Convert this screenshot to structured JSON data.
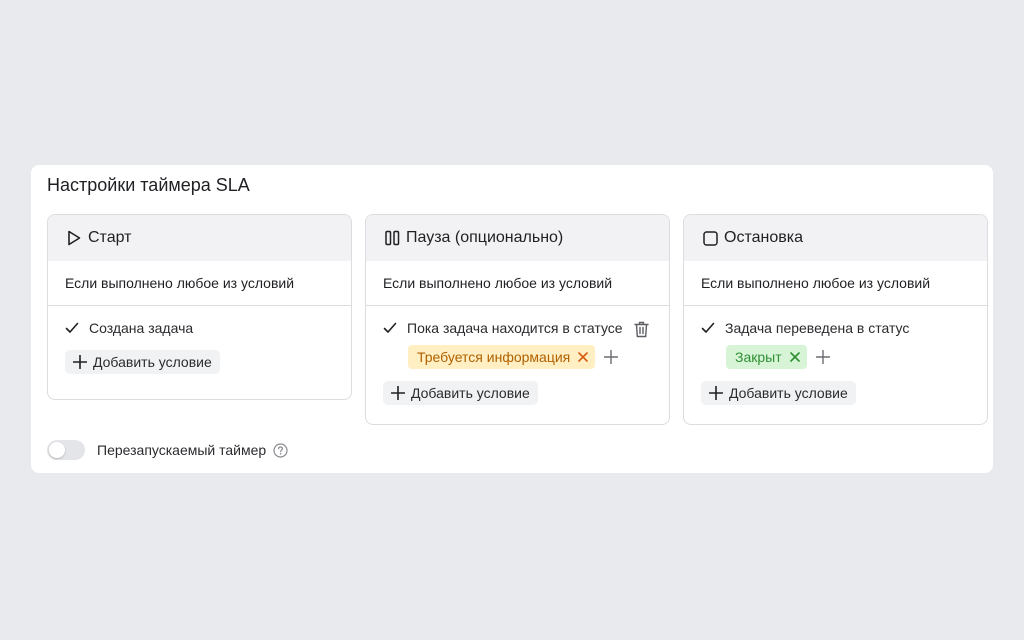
{
  "panel": {
    "title": "Настройки таймера SLA"
  },
  "cards": {
    "start": {
      "title": "Старт",
      "icon": "play-icon",
      "subtitle": "Если выполнено любое из условий",
      "condition": "Создана задача",
      "add_label": "Добавить условие"
    },
    "pause": {
      "title": "Пауза (опционально)",
      "icon": "pause-icon",
      "subtitle": "Если выполнено любое из условий",
      "condition": "Пока задача находится в статусе",
      "tag": "Требуется информация",
      "add_label": "Добавить условие"
    },
    "stop": {
      "title": "Остановка",
      "icon": "stop-icon",
      "subtitle": "Если выполнено любое из условий",
      "condition": "Задача переведена в статус",
      "tag": "Закрыт",
      "add_label": "Добавить условие"
    }
  },
  "toggle": {
    "label": "Перезапускаемый таймер",
    "enabled": false
  },
  "colors": {
    "tag_yellow_bg": "#ffefc2",
    "tag_yellow_text": "#b06100",
    "tag_green_bg": "#d7f5d6",
    "tag_green_text": "#2f8f34"
  }
}
